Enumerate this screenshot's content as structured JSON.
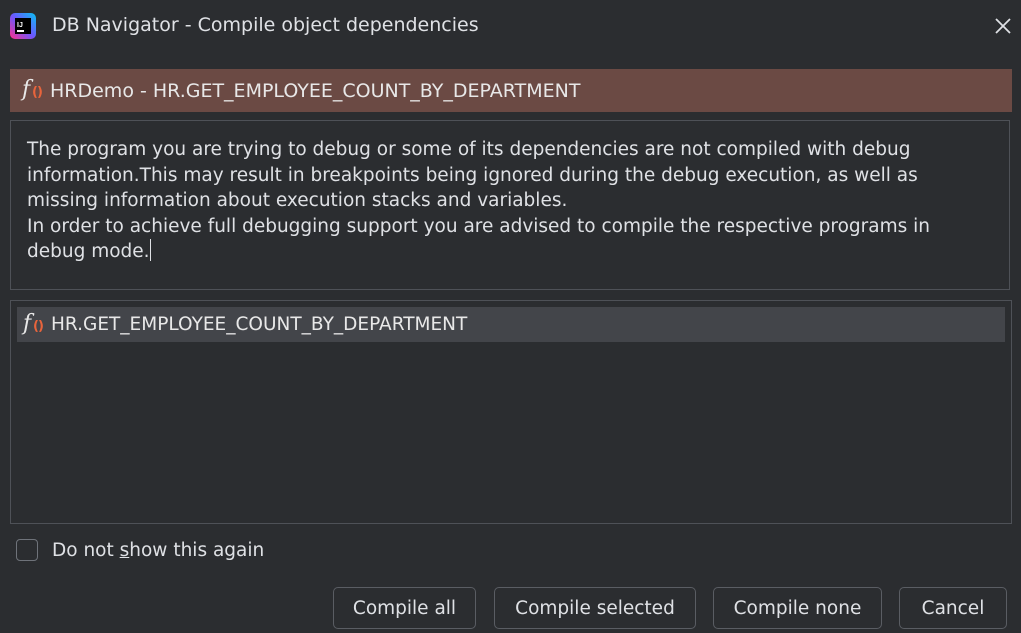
{
  "window": {
    "title": "DB Navigator - Compile object dependencies",
    "app_icon": "intellij-icon",
    "close_icon": "close-icon"
  },
  "header": {
    "icon": "function-icon",
    "text": "HRDemo - HR.GET_EMPLOYEE_COUNT_BY_DEPARTMENT"
  },
  "message": {
    "line1": "The program you are trying to debug or some of its dependencies are not compiled with debug information.This may result in breakpoints being ignored during the debug execution, as well as missing information about execution stacks and variables.",
    "line2": "In order to achieve full debugging support you are advised to compile the respective programs in debug mode."
  },
  "objects": [
    {
      "icon": "function-icon",
      "name": "HR.GET_EMPLOYEE_COUNT_BY_DEPARTMENT"
    }
  ],
  "checkbox": {
    "label_before": "Do not ",
    "label_mnemonic": "s",
    "label_after": "how this again",
    "checked": false
  },
  "buttons": {
    "compile_all": "Compile all",
    "compile_selected": "Compile selected",
    "compile_none": "Compile none",
    "cancel": "Cancel"
  },
  "colors": {
    "background": "#2b2d30",
    "header_bar": "#6b4a44",
    "selected_row": "#43454a",
    "function_accent": "#e8643c"
  }
}
